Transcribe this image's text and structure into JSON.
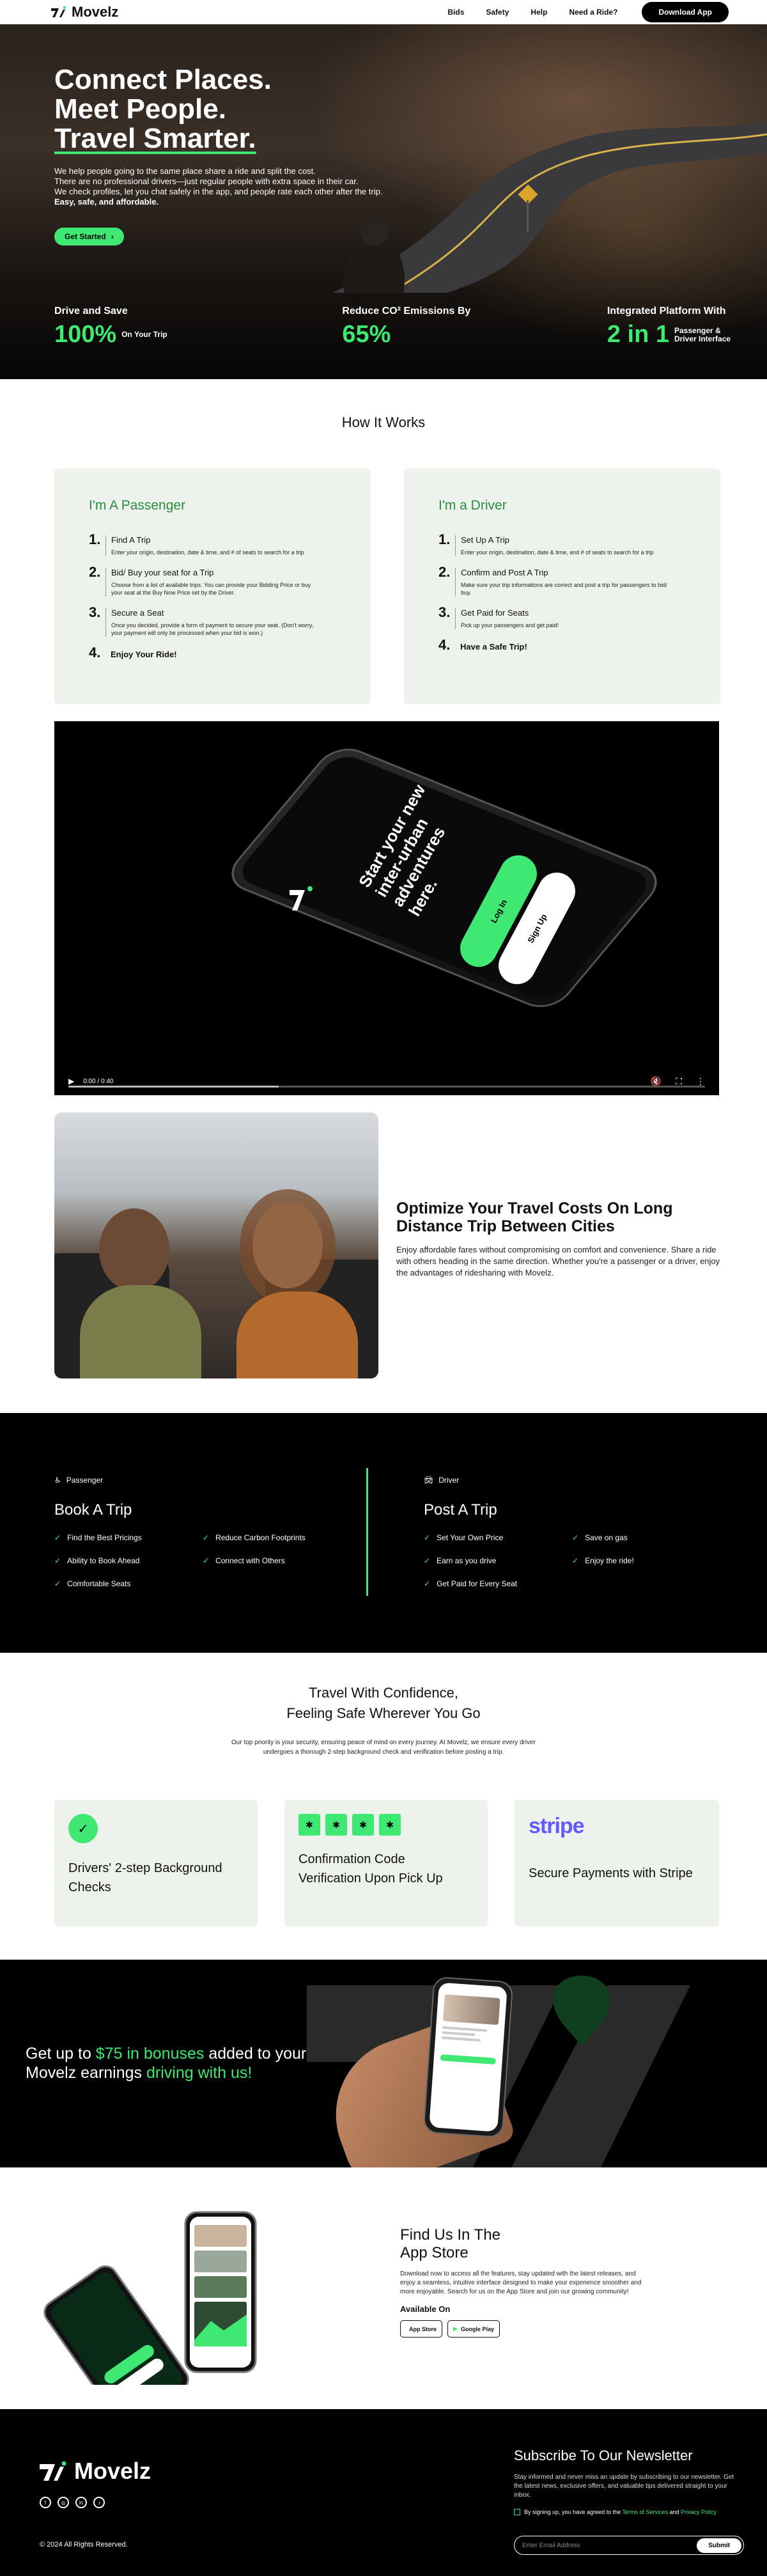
{
  "nav": {
    "brand": "Movelz",
    "links": [
      "Bids",
      "Safety",
      "Help",
      "Need a Ride?"
    ],
    "download": "Download App"
  },
  "hero": {
    "title": [
      "Connect Places.",
      "Meet People.",
      "Travel Smarter."
    ],
    "lines": [
      "We help people going to the same place share a ride and split the cost.",
      "There are no professional drivers—just regular people with extra space in their car.",
      "We check profiles, let you chat safely in the app, and people rate each other after the trip."
    ],
    "tagline": "Easy, safe, and affordable.",
    "cta": "Get Started",
    "stats": [
      {
        "label": "Drive and Save",
        "value": "100%",
        "sub": "On Your Trip"
      },
      {
        "label": "Reduce CO² Emissions By",
        "value": "65%",
        "sub": ""
      },
      {
        "label": "Integrated Platform With",
        "value": "2 in 1",
        "sub": "Passenger & Driver Interface"
      }
    ]
  },
  "how": {
    "title": "How It Works",
    "passenger": {
      "heading": "I'm A Passenger",
      "steps": [
        {
          "n": "1.",
          "title": "Find A Trip",
          "desc": "Enter your origin, destination, date & time, and # of seats to search for a trip"
        },
        {
          "n": "2.",
          "title": "Bid/ Buy your seat for a Trip",
          "desc": "Choose from a list of available trips. You can provide your Bidding Price or buy your seat at the Buy Now Price set by the Driver."
        },
        {
          "n": "3.",
          "title": "Secure a Seat",
          "desc": "Once you decided, provide a form of payment to secure your seat. (Don't worry, your payment will only be processed when your bid is won.)"
        },
        {
          "n": "4.",
          "title": "Enjoy Your Ride!",
          "desc": ""
        }
      ]
    },
    "driver": {
      "heading": "I'm a Driver",
      "steps": [
        {
          "n": "1.",
          "title": "Set Up A Trip",
          "desc": "Enter your origin, destination, date & time, and # of seats to search for a trip"
        },
        {
          "n": "2.",
          "title": "Confirm and Post A Trip",
          "desc": "Make sure your trip informations are correct and post a trip for passengers to bid/ buy."
        },
        {
          "n": "3.",
          "title": "Get Paid for Seats",
          "desc": "Pick up your passengers and get paid!"
        },
        {
          "n": "4.",
          "title": "Have a Safe Trip!",
          "desc": ""
        }
      ]
    }
  },
  "video": {
    "app_text": "Start your new inter-urban adventures here.",
    "login": "Log In",
    "signup": "Sign Up",
    "time": "0:00 / 0:40",
    "progress": 0.33
  },
  "optimize": {
    "title": "Optimize Your Travel Costs On Long Distance Trip Between Cities",
    "body": "Enjoy affordable fares without compromising on comfort and convenience. Share a ride with others heading in the same direction. Whether you're a passenger or a driver, enjoy the advantages of ridesharing with Movelz."
  },
  "book": {
    "passenger": {
      "role": "Passenger",
      "title": "Book A Trip",
      "features": [
        "Find the Best Pricings",
        "Reduce Carbon Footprints",
        "Ability to Book Ahead",
        "Connect with Others",
        "Comfortable Seats"
      ]
    },
    "driver": {
      "role": "Driver",
      "title": "Post A Trip",
      "features": [
        "Set Your Own Price",
        "Save on gas",
        "Earn as you drive",
        "Enjoy the ride!",
        "Get Paid for Every Seat"
      ]
    }
  },
  "confidence": {
    "title": [
      "Travel With Confidence,",
      "Feeling Safe Wherever You Go"
    ],
    "subtitle": "Our top priority is your security, ensuring peace of mind on every journey. At Movelz, we ensure every driver undergoes a thorough 2-step background check and verification before posting a trip.",
    "cards": [
      {
        "title": "Drivers' 2-step Background Checks"
      },
      {
        "title": "Confirmation Code Verification Upon Pick Up"
      },
      {
        "title": "Secure Payments with Stripe",
        "brand": "stripe"
      }
    ]
  },
  "bonus": {
    "pre": "Get up to ",
    "amount": "$75 in bonuses",
    "mid": " added to your",
    "line2": "Movelz earnings ",
    "highlight": "driving with us!"
  },
  "app": {
    "title": [
      "Find Us In The",
      "App Store"
    ],
    "body": "Download now to access all the features, stay updated with the latest releases, and enjoy a seamless, intuitive interface designed to make your experience smoother and more enjoyable. Search for us on the App Store and join our growing community!",
    "available": "Available On",
    "stores": [
      "App Store",
      "Google Play"
    ]
  },
  "footer": {
    "brand": "Movelz",
    "copyright": "© 2024 All Rights Reserved.",
    "newsletter_title": "Subscribe To Our Newsletter",
    "newsletter_body": "Stay informed and never miss an update by subscribing to our newsletter. Get the latest news, exclusive offers, and valuable tips delivered straight to your inbox.",
    "agree_pre": "By signing up, you have agreed to the ",
    "terms": "Terms of Services",
    "and": " and ",
    "privacy": "Privacy Policy",
    "email_placeholder": "Enter Email Address",
    "submit": "Submit"
  },
  "colors": {
    "accent": "#3ee872",
    "dark": "#000000",
    "card": "#eef2ec",
    "stripe": "#635bff"
  }
}
